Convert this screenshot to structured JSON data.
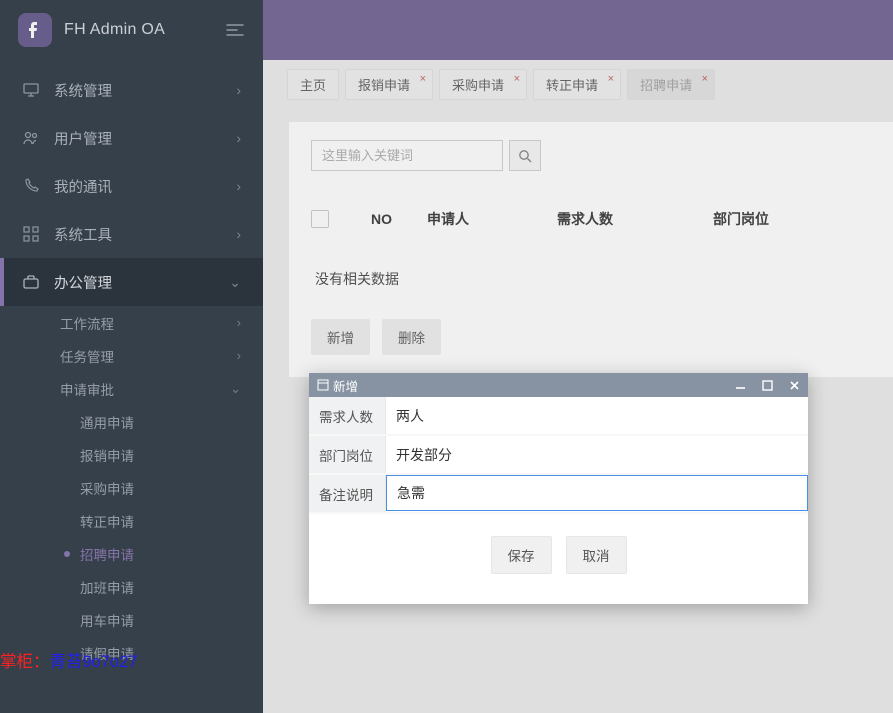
{
  "app": {
    "name": "FH Admin OA"
  },
  "sidebar": {
    "items": [
      {
        "label": "系统管理"
      },
      {
        "label": "用户管理"
      },
      {
        "label": "我的通讯"
      },
      {
        "label": "系统工具"
      },
      {
        "label": "办公管理"
      }
    ],
    "sub": [
      {
        "label": "工作流程"
      },
      {
        "label": "任务管理"
      },
      {
        "label": "申请审批"
      }
    ],
    "applications": [
      {
        "label": "通用申请"
      },
      {
        "label": "报销申请"
      },
      {
        "label": "采购申请"
      },
      {
        "label": "转正申请"
      },
      {
        "label": "招聘申请"
      },
      {
        "label": "加班申请"
      },
      {
        "label": "用车申请"
      },
      {
        "label": "请假申请"
      }
    ]
  },
  "tabs": [
    {
      "label": "主页",
      "closable": false
    },
    {
      "label": "报销申请",
      "closable": true
    },
    {
      "label": "采购申请",
      "closable": true
    },
    {
      "label": "转正申请",
      "closable": true
    },
    {
      "label": "招聘申请",
      "closable": true
    }
  ],
  "search": {
    "placeholder": "这里输入关键词"
  },
  "table": {
    "cols": {
      "no": "NO",
      "applicant": "申请人",
      "need": "需求人数",
      "position": "部门岗位"
    },
    "empty": "没有相关数据"
  },
  "ops": {
    "add": "新增",
    "del": "删除"
  },
  "modal": {
    "title": "新增",
    "fields": {
      "need_label": "需求人数",
      "need_value": "两人",
      "pos_label": "部门岗位",
      "pos_value": "开发部分",
      "note_label": "备注说明",
      "note_value": "急需"
    },
    "save": "保存",
    "cancel": "取消"
  },
  "watermark": {
    "a": "掌柜：",
    "b": "青苔9o7o27"
  }
}
